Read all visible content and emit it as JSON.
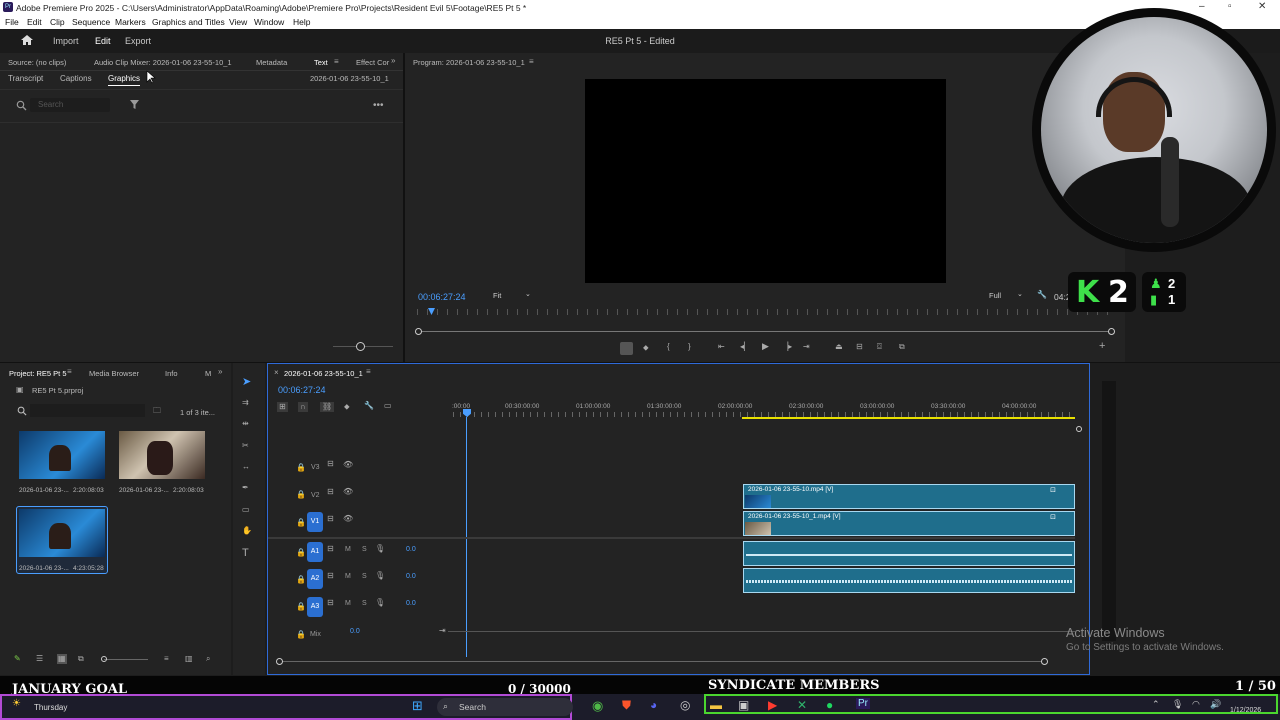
{
  "window": {
    "title": "Adobe Premiere Pro 2025 - C:\\Users\\Administrator\\AppData\\Roaming\\Adobe\\Premiere Pro\\Projects\\Resident Evil 5\\Footage\\RE5 Pt 5 *"
  },
  "menu": [
    "File",
    "Edit",
    "Clip",
    "Sequence",
    "Markers",
    "Graphics and Titles",
    "View",
    "Window",
    "Help"
  ],
  "header": {
    "nav": [
      "Import",
      "Edit",
      "Export"
    ],
    "active_nav": "Edit",
    "project_status": "RE5 Pt 5 - Edited"
  },
  "source_panel": {
    "tabs": [
      "Source: (no clips)",
      "Audio Clip Mixer: 2026-01-06 23-55-10_1",
      "Metadata",
      "Text",
      "Effect Cor"
    ],
    "subtabs": [
      "Transcript",
      "Captions",
      "Graphics"
    ],
    "active_subtab": "Graphics",
    "sequence_name": "2026-01-06 23-55-10_1",
    "search_placeholder": "Search"
  },
  "program_panel": {
    "title": "Program: 2026-01-06 23-55-10_1",
    "timecode": "00:06:27:24",
    "zoom": "Fit",
    "resolution": "Full",
    "end_timecode": "04:2"
  },
  "project_panel": {
    "tabs": [
      "Project: RE5 Pt 5",
      "Media Browser",
      "Info",
      "M"
    ],
    "project_file": "RE5 Pt 5.prproj",
    "item_count": "1 of 3 ite...",
    "items": [
      {
        "name": "2026-01-06 23-...",
        "duration": "2:20:08:03"
      },
      {
        "name": "2026-01-06 23-...",
        "duration": "2:20:08:03"
      },
      {
        "name": "2026-01-06 23-...",
        "duration": "4:23:05:28"
      }
    ]
  },
  "timeline": {
    "sequence_tab": "2026-01-06 23-55-10_1",
    "timecode": "00:06:27:24",
    "ruler": [
      ":00:00",
      "00:30:00:00",
      "01:00:00:00",
      "01:30:00:00",
      "02:00:00:00",
      "02:30:00:00",
      "03:00:00:00",
      "03:30:00:00",
      "04:00:00:00"
    ],
    "video_tracks": [
      "V3",
      "V2",
      "V1"
    ],
    "audio_tracks": [
      {
        "name": "A1",
        "level": "0.0"
      },
      {
        "name": "A2",
        "level": "0.0"
      },
      {
        "name": "A3",
        "level": "0.0"
      }
    ],
    "mix_label": "Mix",
    "mix_level": "0.0",
    "clips": {
      "v2": "2026-01-06 23-55-10.mp4 [V]",
      "v1": "2026-01-06 23-55-10_1.mp4 [V]"
    },
    "track_buttons": {
      "mute": "M",
      "solo": "S"
    }
  },
  "overlay": {
    "score_letter": "K",
    "score_value": "2",
    "badge_top": "2",
    "badge_bottom": "1",
    "activate_title": "Activate Windows",
    "activate_sub": "Go to Settings to activate Windows.",
    "goal_label": "JANUARY GOAL",
    "goal_count": "0 / 30000",
    "members_label": "SYNDICATE MEMBERS",
    "members_count": "1 / 50"
  },
  "taskbar": {
    "weather": "Thursday",
    "search": "Search",
    "date": "1/12/2026"
  },
  "colors": {
    "accent": "#2b6fd1",
    "clip": "#1f6e8c",
    "goal_bar": "#b24bd6",
    "members_bar": "#4bd62f"
  }
}
